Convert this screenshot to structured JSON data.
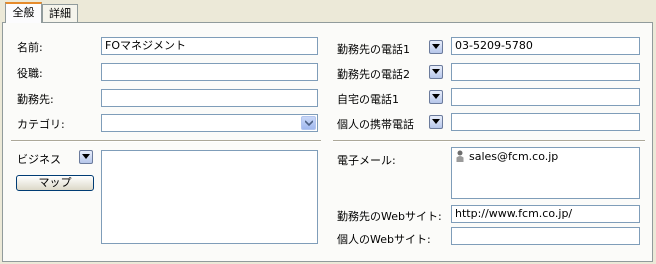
{
  "tabs": [
    {
      "label": "全般"
    },
    {
      "label": "詳細"
    }
  ],
  "left": {
    "name": {
      "label": "名前:",
      "value": "FOマネジメント"
    },
    "title": {
      "label": "役職:",
      "value": ""
    },
    "company": {
      "label": "勤務先:",
      "value": ""
    },
    "category": {
      "label": "カテゴリ:",
      "value": ""
    },
    "address_type": {
      "label": "ビジネス"
    },
    "map_button": "マップ"
  },
  "right": {
    "phones": [
      {
        "label": "勤務先の電話1",
        "value": "03-5209-5780"
      },
      {
        "label": "勤務先の電話2",
        "value": ""
      },
      {
        "label": "自宅の電話1",
        "value": ""
      },
      {
        "label": "個人の携帯電話",
        "value": ""
      }
    ],
    "email": {
      "label": "電子メール:",
      "value": "sales@fcm.co.jp"
    },
    "work_web": {
      "label": "勤務先のWebサイト:",
      "value": "http://www.fcm.co.jp/"
    },
    "personal_web": {
      "label": "個人のWebサイト:",
      "value": ""
    }
  },
  "icons": {
    "dropdown": "chevron-down-icon",
    "email": "person-icon"
  }
}
